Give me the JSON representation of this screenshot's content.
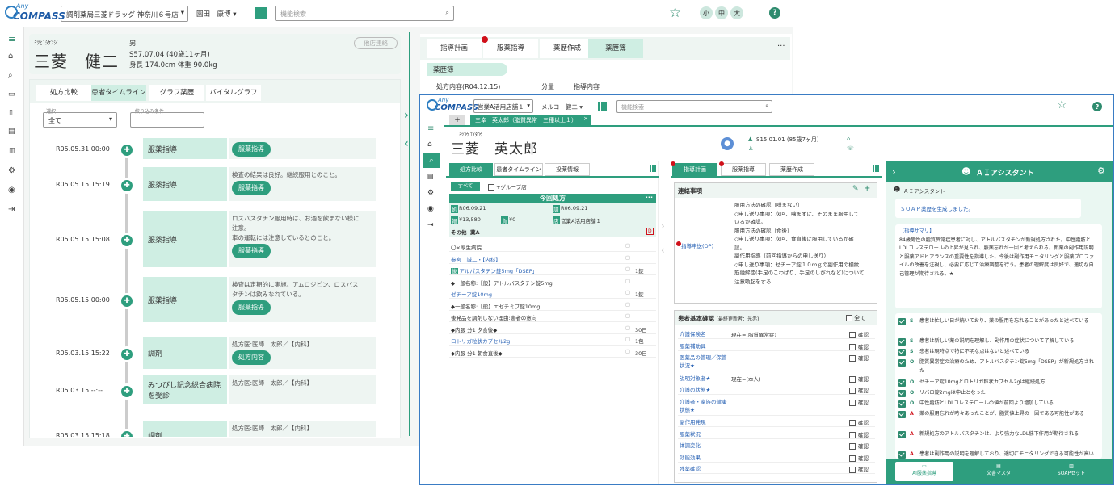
{
  "app": {
    "logo_small": "Any",
    "logo_big": "COMPASS"
  },
  "back": {
    "store": "調剤薬局三菱ドラッグ 神奈川６号店",
    "user": "園田　康博",
    "search_placeholder": "機能検索",
    "font_sizes": [
      "小",
      "中",
      "大"
    ],
    "patient": {
      "kana": "ﾐﾂﾋﾞｼｹﾝｼﾞ",
      "name": "三菱　健二",
      "sex": "男",
      "birth": "S57.07.04 (40歳11ヶ月)",
      "body": "身長 174.0cm 体重 90.0kg",
      "other_link": "他店連絡"
    },
    "tabs": [
      "処方比較",
      "患者タイムライン",
      "グラフ薬歴",
      "バイタルグラフ"
    ],
    "filter_label1": "選択",
    "filter_value": "全て",
    "filter_label2": "絞り込み条件",
    "timeline": [
      {
        "date": "R05.05.31 00:00",
        "title": "服薬指導",
        "text1": "",
        "text2": "",
        "button": "服薬指導"
      },
      {
        "date": "R05.05.15 15:19",
        "title": "服薬指導",
        "text1": "検査の結果は良好。継続服用とのこと。",
        "text2": "",
        "button": "服薬指導"
      },
      {
        "date": "R05.05.15 15:08",
        "title": "服薬指導",
        "text1": "ロスバスタチン服用時は、お酒を飲まない様に",
        "text2": "注意。",
        "text3": "車の運転には注意しているとのこと。",
        "button": "服薬指導"
      },
      {
        "date": "R05.05.15 00:00",
        "title": "服薬指導",
        "text1": "検査は定期的に実施。アムロジピン、ロスバス",
        "text2": "タチンは飲みなれている。",
        "button": "服薬指導"
      },
      {
        "date": "R05.03.15 15:22",
        "title": "調剤",
        "text1": "処方医:医師　太郎／【内科】",
        "button": "処方内容"
      },
      {
        "date": "R05.03.15 --:--",
        "title": "みつびし記念総合病院",
        "title2": "を受診",
        "text1": "処方医:医師　太郎／【内科】"
      },
      {
        "date": "R05.03.15 15:18",
        "title": "調剤",
        "text1": "処方医:医師　太郎／【内科】"
      }
    ],
    "right_tabs": [
      "指導計画",
      "服薬指導",
      "薬歴作成",
      "薬歴簿"
    ],
    "kanreki_title": "薬歴簿",
    "kanreki_cols": [
      "処方内容(R04.12.15)",
      "分量",
      "指導内容"
    ]
  },
  "front": {
    "store": "営業A活用店舗１",
    "user": "メルコ　健二",
    "search_placeholder": "機能検索",
    "tab_plus": "+",
    "tab_label": "三幸　英太郎（脂質異常　三種以上１）",
    "patient": {
      "kana": "ﾐﾂｺｳ ｴｲﾀﾛｳ",
      "name": "三菱　英太郎",
      "birth": "S15.01.01 (85歳7ヶ月)"
    },
    "left_tabs": [
      "処方比較",
      "患者タイムライン",
      "投薬情報"
    ],
    "filter_all": "すべて",
    "group_label": "+グループ店",
    "rx_header": "今回処方",
    "rx_rows": [
      [
        "処",
        "R06.09.21",
        "調",
        "R06.09.21"
      ],
      [
        "報",
        "¥13,580",
        "負",
        "¥0",
        "店",
        "営業A活用店舗１"
      ]
    ],
    "rx_other": "その他",
    "rx_other_val": "薬A",
    "d_badge": "D",
    "rx_items": [
      {
        "t": "〇×厚生病院",
        "link": false,
        "q": ""
      },
      {
        "t": "参宮　誠二・【内科】",
        "link": true,
        "q": ""
      },
      {
        "t": "アルパスタチン錠5mg「DSEP」",
        "link": true,
        "q": "1錠",
        "badge": "後"
      },
      {
        "t": "◆一般名称:【般】アトルバスタチン錠5mg",
        "link": false,
        "q": ""
      },
      {
        "t": "ゼチーア錠10mg",
        "link": true,
        "q": "1錠"
      },
      {
        "t": "◆一般名称:【般】エゼチミブ錠10mg",
        "link": false,
        "q": ""
      },
      {
        "t": "後発品を調剤しない理由:患者の意向",
        "link": false,
        "q": ""
      },
      {
        "t": "◆内服 分1 夕食後◆",
        "link": false,
        "q": "30日"
      },
      {
        "t": "ロトリガ粒状カプセル2g",
        "link": true,
        "q": "1包"
      },
      {
        "t": "◆内服 分1 朝食直後◆",
        "link": false,
        "q": "30日"
      }
    ],
    "mid_tabs": [
      "指導計画",
      "服薬指導",
      "薬歴作成"
    ],
    "contact_title": "連絡事項",
    "contact_label": "指導申送(OP)",
    "contact_text": [
      "服用方法の確認（唾まない）",
      "◇申し送り事項：次回、噛まずに、そのまま服用して",
      "いるか確認。",
      "服用方法の確認（食後）",
      "◇申し送り事項：次回、食直後に服用しているか確",
      "認。",
      "副作用指導（前回指導からの申し送り）",
      "◇申し送り事項：ゼチーア錠１０ｍｇの副作用の横紋",
      "筋融解症(手足のこわばり、手足のしびれなど)について",
      "注意喚起をする"
    ],
    "basic_title": "患者基本確認",
    "basic_sub": "(最終更新者：光赤)",
    "basic_all": "全て",
    "basic_rows": [
      {
        "l": "介護保険名",
        "v": "現在=(脂質異常症)",
        "c": "確認"
      },
      {
        "l": "服薬補助具",
        "v": "",
        "c": "確認"
      },
      {
        "l": "医薬品の管理／保管状況★",
        "v": "",
        "c": "確認"
      },
      {
        "l": "説明対象者★",
        "v": "現在=(本人)",
        "c": "確認"
      },
      {
        "l": "介護の状態★",
        "v": "",
        "c": "確認"
      },
      {
        "l": "介護者・家族の健康状態★",
        "v": "",
        "c": "確認"
      },
      {
        "l": "副作用発現",
        "v": "",
        "c": "確認"
      },
      {
        "l": "服薬状況",
        "v": "",
        "c": "確認"
      },
      {
        "l": "体調変化",
        "v": "",
        "c": "確認"
      },
      {
        "l": "効能効果",
        "v": "",
        "c": "確認"
      },
      {
        "l": "残薬確認",
        "v": "",
        "c": "確認"
      }
    ],
    "ai": {
      "title": "ＡＩアシスタント",
      "sub": "ＡＩアシスタント",
      "msg": "ＳＯＡＰ薬歴を生成しました。",
      "summary_title": "【指導サマリ】",
      "summary": "84歳男性の脂質異常症患者に対し、アトルバスタチンが新規処方された。中性脂肪とLDLコレステロールの上昇が見られ、服薬忘れが一因と考えられる。新薬の副作用説明と服薬アドヒアランスの重要性を指導した。今後は副作用モニタリングと服薬プロファイルの改善を注視し、必要に応じて治療調整を行う。患者の理解度は良好で、適切な自己管理が期待される。★",
      "soap": [
        {
          "k": "S",
          "t": "患者は忙しい日が続いており、薬の服用を忘れることがあったと述べている"
        },
        {
          "k": "S",
          "t": "患者は新しい薬の説明を理解し、副作用の症状について了解している"
        },
        {
          "k": "S",
          "t": "患者は現時点で特に不明な点はないと述べている"
        },
        {
          "k": "O",
          "t": "脂質異常症の治療のため、アトルバスタチン錠5mg「DSEP」が新規処方された"
        },
        {
          "k": "O",
          "t": "ゼチーア錠10mgとロトリガ粒状カプセル2gは継続処方"
        },
        {
          "k": "O",
          "t": "リバロ錠2mgは中止となった"
        },
        {
          "k": "O",
          "t": "中性脂肪とLDLコレステロールの値が前回より増加している"
        },
        {
          "k": "A",
          "t": "薬の服用忘れが時々あったことが、脂質値上昇の一因である可能性がある"
        },
        {
          "k": "A",
          "t": "新規処方のアトルバスタチンは、より強力なLDL低下作用が期待される"
        },
        {
          "k": "A",
          "t": "患者は副作用の説明を理解しており、適切にモニタリングできる可能性が高い"
        }
      ],
      "footer": [
        "AI服薬指導",
        "文書マスタ",
        "SOAPセット"
      ]
    }
  },
  "colors": {
    "accent": "#2e9e7e",
    "light": "#cfeee3",
    "panel": "#eaf7f2",
    "dark": "#1f6f58"
  }
}
